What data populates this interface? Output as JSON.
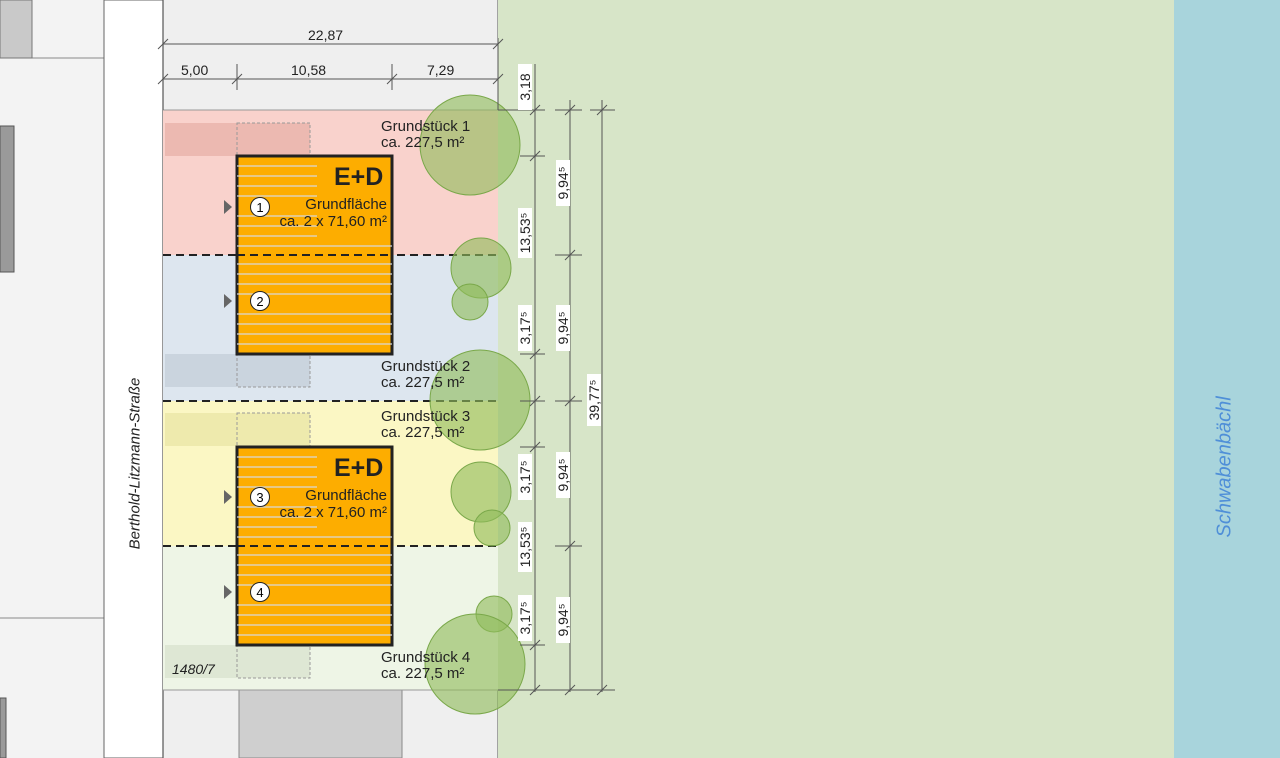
{
  "street_name": "Berthold-Litzmann-Straße",
  "river_name": "Schwabenbächl",
  "parcel_id": "1480/7",
  "dimensions_top": {
    "total": "22,87",
    "segments": [
      "5,00",
      "10,58",
      "7,29"
    ]
  },
  "plots": [
    {
      "name": "Grundstück 1",
      "area": "ca. 227,5 m²",
      "color": "#f9d2cc"
    },
    {
      "name": "Grundstück 2",
      "area": "ca. 227,5 m²",
      "color": "#dde6ef"
    },
    {
      "name": "Grundstück 3",
      "area": "ca. 227,5 m²",
      "color": "#fbf7c4"
    },
    {
      "name": "Grundstück 4",
      "area": "ca. 227,5 m²",
      "color": "#eef5e6"
    }
  ],
  "houses": [
    {
      "title": "E+D",
      "area_label": "Grundfläche",
      "area_value": "ca. 2 x 71,60 m²",
      "units": [
        "1",
        "2"
      ]
    },
    {
      "title": "E+D",
      "area_label": "Grundfläche",
      "area_value": "ca. 2 x 71,60 m²",
      "units": [
        "3",
        "4"
      ]
    }
  ],
  "dims_col1": [
    "3,18",
    "13,53⁵",
    "3,17⁵",
    "3,17⁵",
    "13,53⁵",
    "3,17⁵"
  ],
  "dims_col2": [
    "9,94⁵",
    "9,94⁵",
    "9,94⁵",
    "9,94⁵"
  ],
  "dims_col3": "39,77⁵",
  "colors": {
    "house": "#fdad00",
    "green_area": "#d7e5c8",
    "river": "#a8d4dc",
    "tree": "#8fbc5a"
  }
}
